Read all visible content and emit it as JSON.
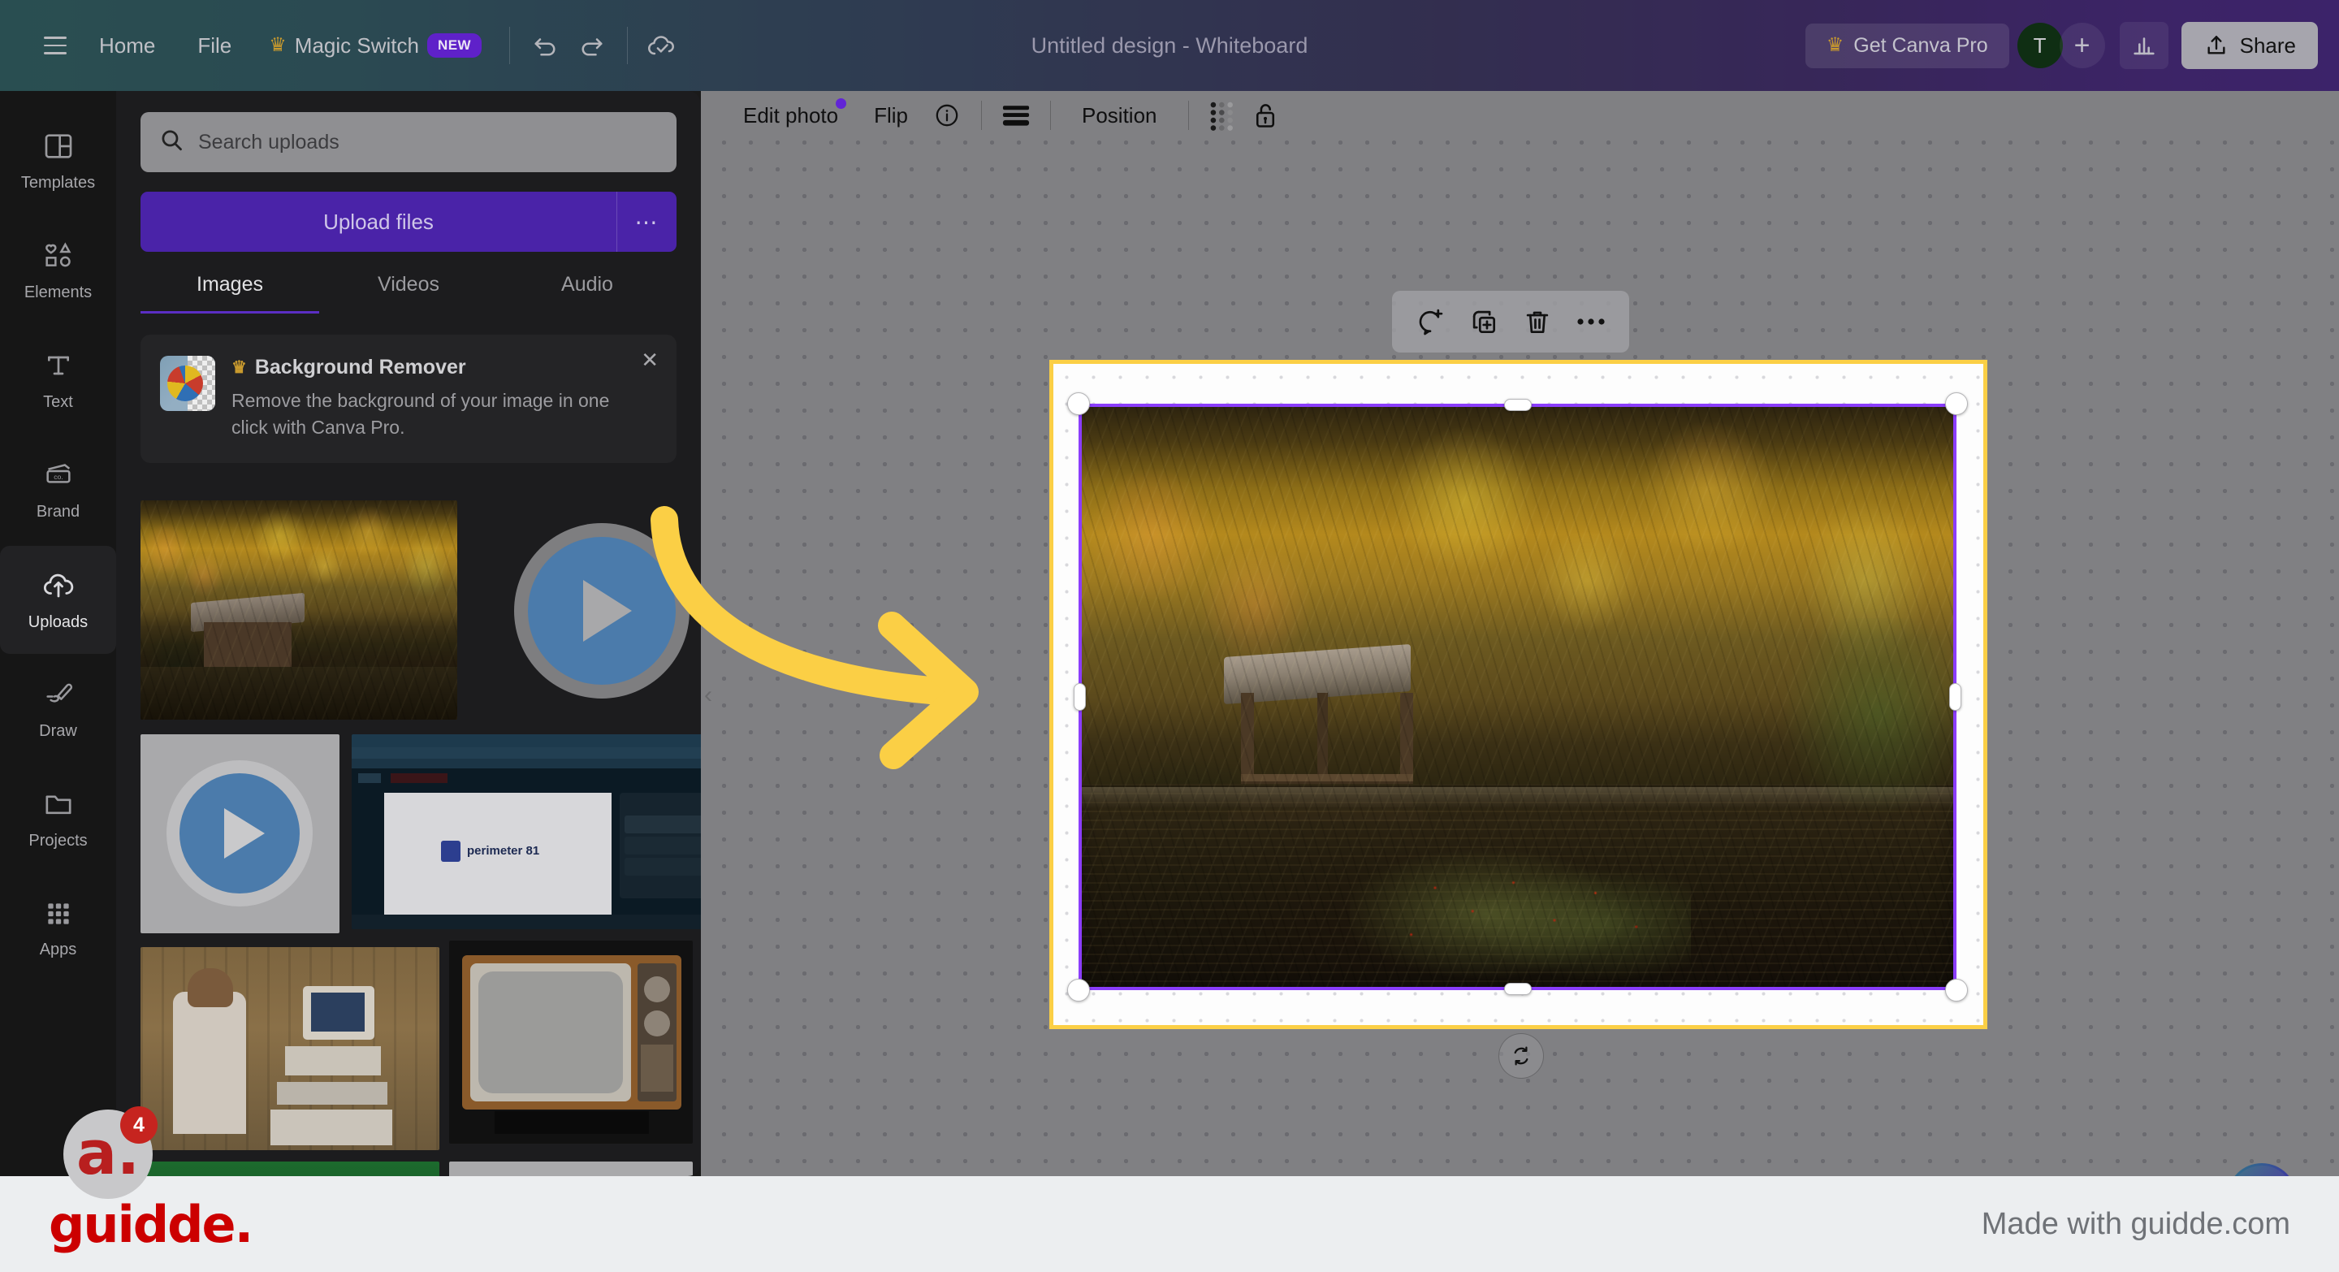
{
  "app": {
    "title": "Untitled design - Whiteboard"
  },
  "topbar": {
    "menu_icon": "hamburger-icon",
    "home": "Home",
    "file": "File",
    "magic_switch": "Magic Switch",
    "magic_switch_badge": "NEW",
    "undo_icon": "undo-icon",
    "redo_icon": "redo-icon",
    "saved_icon": "cloud-check-icon",
    "get_pro": "Get Canva Pro",
    "crown_icon": "crown-icon",
    "avatar_initial": "T",
    "add_icon": "plus-icon",
    "insights_icon": "bar-chart-icon",
    "share": "Share",
    "share_icon": "upload-icon"
  },
  "sidebar": {
    "items": [
      {
        "label": "Templates",
        "icon": "templates-icon",
        "active": false
      },
      {
        "label": "Elements",
        "icon": "elements-icon",
        "active": false
      },
      {
        "label": "Text",
        "icon": "text-icon",
        "active": false
      },
      {
        "label": "Brand",
        "icon": "brand-icon",
        "active": false
      },
      {
        "label": "Uploads",
        "icon": "uploads-cloud-icon",
        "active": true
      },
      {
        "label": "Draw",
        "icon": "draw-pen-icon",
        "active": false
      },
      {
        "label": "Projects",
        "icon": "folder-icon",
        "active": false
      },
      {
        "label": "Apps",
        "icon": "apps-grid-icon",
        "active": false
      }
    ]
  },
  "uploads_panel": {
    "search_placeholder": "Search uploads",
    "search_icon": "search-icon",
    "upload_button": "Upload files",
    "upload_more_icon": "ellipsis-icon",
    "tabs": [
      {
        "label": "Images",
        "active": true
      },
      {
        "label": "Videos",
        "active": false
      },
      {
        "label": "Audio",
        "active": false
      }
    ],
    "promo": {
      "title": "Background Remover",
      "crown_icon": "crown-icon",
      "body": "Remove the background of your image in one click with Canva Pro.",
      "close_icon": "close-icon",
      "thumb_icon": "beachball-transparency-thumb"
    },
    "thumbnails": [
      {
        "name": "autumn-pond-photo",
        "kind": "image"
      },
      {
        "name": "video-thumbnail-grey",
        "kind": "video"
      },
      {
        "name": "perimeter81-youtube-screenshot",
        "kind": "video"
      },
      {
        "name": "retro-computer-man-photo",
        "kind": "image"
      },
      {
        "name": "vintage-tv-photo",
        "kind": "image"
      },
      {
        "name": "green-thumbnail",
        "kind": "image"
      },
      {
        "name": "light-grey-thumbnail",
        "kind": "image"
      }
    ]
  },
  "edit_toolbar": {
    "edit_photo": "Edit photo",
    "edit_photo_badge_color": "#6124d6",
    "flip": "Flip",
    "info_icon": "info-circle-icon",
    "lines_icon": "align-lines-icon",
    "position": "Position",
    "transparency_icon": "transparency-dots-icon",
    "lock_icon": "lock-open-icon"
  },
  "context_menu": {
    "comment_icon": "comment-add-icon",
    "duplicate_icon": "duplicate-icon",
    "delete_icon": "trash-icon",
    "more_icon": "ellipsis-icon"
  },
  "canvas": {
    "selected_element": "autumn-pond-image",
    "selection_color": "#8b3dfb",
    "frame_border_color": "#fbcf45",
    "background_color": "#808083",
    "rotate_icon": "rotate-icon",
    "collapse_icon": "chevron-left-icon",
    "ai_icon": "magic-sparkle-icon",
    "ai_border_colors": [
      "#2e7a86",
      "#3b3f9e",
      "#6b2fa8"
    ]
  },
  "annotation": {
    "arrow_color": "#fbcf45",
    "arrow_name": "curved-arrow-annotation"
  },
  "guidde_badge": {
    "letter": "a.",
    "count": "4",
    "brand_color": "#b81f1f"
  },
  "footer": {
    "logo": "guidde.",
    "made_with": "Made with guidde.com",
    "logo_color": "#cc0000"
  }
}
